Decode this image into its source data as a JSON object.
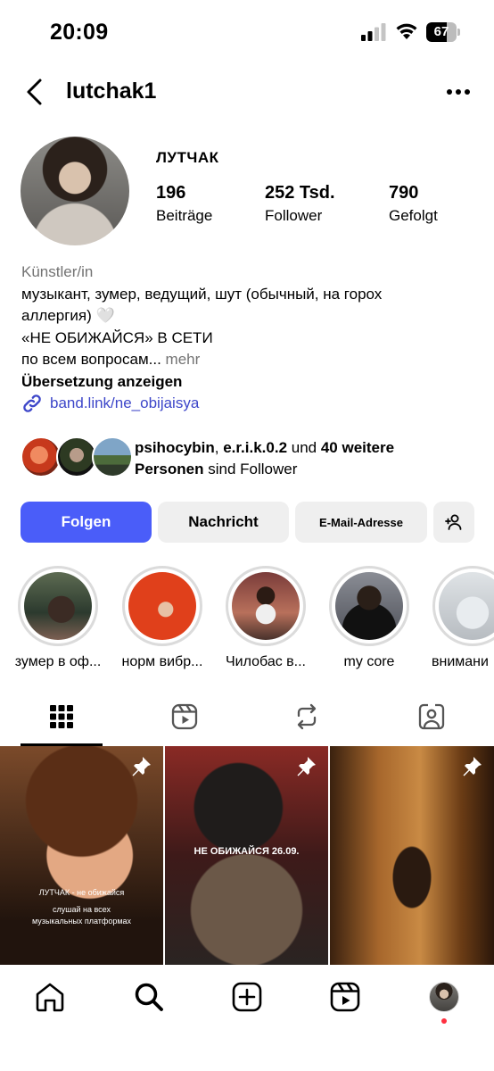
{
  "status_bar": {
    "time": "20:09",
    "battery": "67",
    "battery_level": 0.67
  },
  "header": {
    "username": "lutchak1",
    "back_icon": "chevron-left-icon",
    "more_icon": "more-horizontal-icon"
  },
  "profile": {
    "display_name": "ЛУТЧАК",
    "stats": [
      {
        "value": "196",
        "label": "Beiträge"
      },
      {
        "value": "252 Tsd.",
        "label": "Follower"
      },
      {
        "value": "790",
        "label": "Gefolgt"
      }
    ],
    "bio": {
      "category": "Künstler/in",
      "line1": "музыкант, зумер, ведущий, шут (обычный, на горох",
      "line2": "аллергия) 🤍",
      "line3": "«НЕ ОБИЖАЙСЯ» В СЕТИ",
      "line4": "по всем вопросам...",
      "more": "mehr",
      "translate": "Übersetzung anzeigen",
      "link": "band.link/ne_obijaisya"
    },
    "followed_by": {
      "name1": "psihocybin",
      "sep": ", ",
      "name2": "e.r.i.k.0.2",
      "and": " und ",
      "count": "40 weitere",
      "personen": "Personen",
      "suffix": " sind Follower"
    }
  },
  "buttons": {
    "follow": "Folgen",
    "message": "Nachricht",
    "email": "E-Mail-Adresse",
    "add_user_icon": "add-user-icon"
  },
  "highlights": [
    {
      "label": "зумер в оф..."
    },
    {
      "label": "норм вибр..."
    },
    {
      "label": "Чилобас в..."
    },
    {
      "label": "my core"
    },
    {
      "label": "внимани"
    }
  ],
  "tabs": [
    "grid-icon",
    "reels-icon",
    "reposts-icon",
    "tagged-icon"
  ],
  "posts": [
    {
      "caption_title": "ЛУТЧАК - не обижайся",
      "caption_sub1": "слушай на всех",
      "caption_sub2": "музыкальных платформах",
      "pinned": true
    },
    {
      "caption_title": "НЕ ОБИЖАЙСЯ 26.09.",
      "pinned": true
    },
    {
      "pinned": true
    }
  ],
  "bottom_nav": [
    "home-icon",
    "search-icon",
    "create-icon",
    "reels-icon",
    "profile-avatar"
  ]
}
